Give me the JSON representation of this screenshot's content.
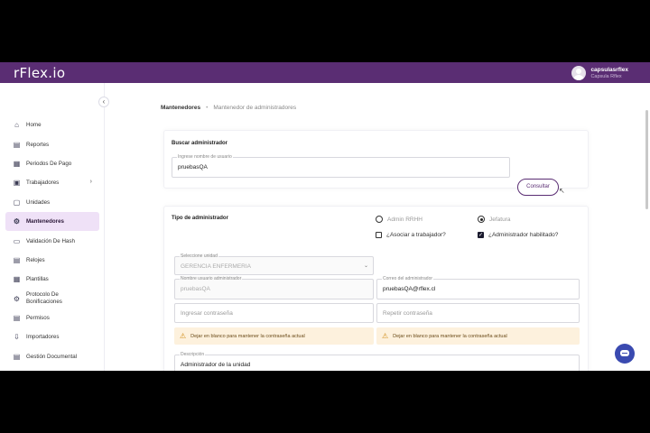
{
  "app": {
    "name": "rFlex.io"
  },
  "user": {
    "name": "capsulasrflex",
    "subtitle": "Capsula Rflex"
  },
  "sidebar": {
    "collapse_icon": "chevron-left-icon",
    "items": [
      {
        "label": "Home",
        "icon": "home-icon"
      },
      {
        "label": "Reportes",
        "icon": "report-icon"
      },
      {
        "label": "Periodos De Pago",
        "icon": "calendar-icon"
      },
      {
        "label": "Trabajadores",
        "icon": "workers-icon",
        "has_children": true
      },
      {
        "label": "Unidades",
        "icon": "units-icon"
      },
      {
        "label": "Mantenedores",
        "icon": "settings-icon",
        "active": true
      },
      {
        "label": "Validación De Hash",
        "icon": "hash-icon"
      },
      {
        "label": "Relojes",
        "icon": "clock-icon"
      },
      {
        "label": "Plantillas",
        "icon": "template-icon"
      },
      {
        "label": "Protocolo De Bonificaciones",
        "icon": "bonus-icon"
      },
      {
        "label": "Permisos",
        "icon": "permissions-icon"
      },
      {
        "label": "Importadores",
        "icon": "import-icon"
      },
      {
        "label": "Gestión Documental",
        "icon": "documents-icon"
      }
    ]
  },
  "breadcrumb": {
    "root": "Mantenedores",
    "separator": "•",
    "current": "Mantenedor de administradores"
  },
  "search": {
    "title": "Buscar administrador",
    "field_label": "Ingrese nombre de usuario",
    "value": "pruebasQA",
    "button": "Consultar"
  },
  "admin_type": {
    "title": "Tipo de administrador",
    "radio_rrhh": "Admin RRHH",
    "radio_jefatura": "Jefatura",
    "selected": "Jefatura",
    "check_asociar": "¿Asociar a trabajador?",
    "check_asociar_checked": false,
    "check_habilitado": "¿Administrador habilitado?",
    "check_habilitado_checked": true
  },
  "form": {
    "unit_label": "Seleccione unidad",
    "unit_value": "GERENCIA ENFERMERIA",
    "username_label": "Nombre usuario administrador",
    "username_value": "pruebasQA",
    "email_label": "Correo del administrador",
    "email_value": "pruebasQA@rflex.cl",
    "password_placeholder": "Ingresar contraseña",
    "repeat_placeholder": "Repetir contraseña",
    "warning_text": "Dejar en blanco para mantener la contraseña actual",
    "description_label": "Descripción",
    "description_value": "Administrador de la unidad"
  },
  "colors": {
    "brand": "#5a2d73",
    "active_bg": "#efe1f7",
    "warning_bg": "#fdf1dd",
    "fab": "#3a4ab0"
  }
}
